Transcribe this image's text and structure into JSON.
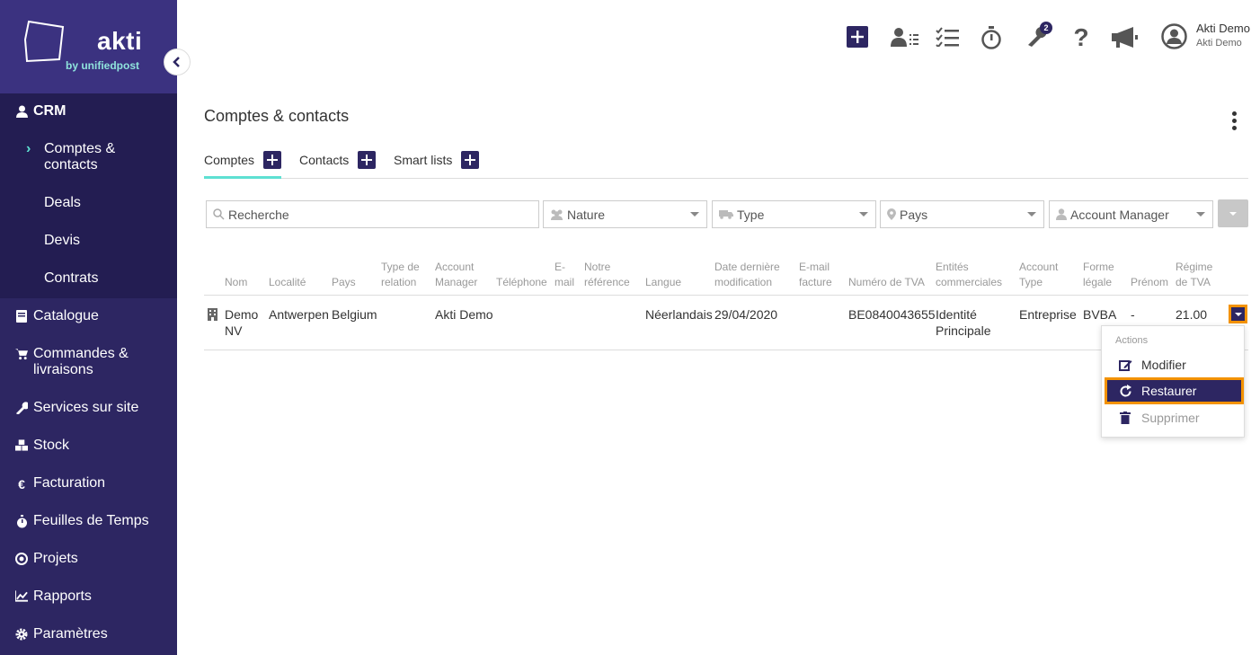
{
  "brand": {
    "name": "akti",
    "sub": "by unifiedpost"
  },
  "user": {
    "name": "Akti Demo",
    "company": "Akti Demo"
  },
  "topbar": {
    "notification_count": "2"
  },
  "sidebar": {
    "crm": "CRM",
    "crm_items": [
      "Comptes &\ncontacts",
      "Deals",
      "Devis",
      "Contrats"
    ],
    "items": [
      {
        "label": "Catalogue",
        "icon": "book-icon"
      },
      {
        "label": "Commandes &\nlivraisons",
        "icon": "cart-icon"
      },
      {
        "label": "Services sur site",
        "icon": "wrench-icon"
      },
      {
        "label": "Stock",
        "icon": "cubes-icon"
      },
      {
        "label": "Facturation",
        "icon": "euro-icon"
      },
      {
        "label": "Feuilles de Temps",
        "icon": "stopwatch-icon"
      },
      {
        "label": "Projets",
        "icon": "target-icon"
      },
      {
        "label": "Rapports",
        "icon": "chart-icon"
      },
      {
        "label": "Paramètres",
        "icon": "gear-icon"
      }
    ]
  },
  "page": {
    "title": "Comptes & contacts"
  },
  "tabs": [
    "Comptes",
    "Contacts",
    "Smart lists"
  ],
  "filters": {
    "search_placeholder": "Recherche",
    "nature": "Nature",
    "type": "Type",
    "pays": "Pays",
    "account_manager": "Account Manager"
  },
  "table": {
    "headers": {
      "nom": "Nom",
      "localite": "Localité",
      "pays": "Pays",
      "type_relation": "Type de\nrelation",
      "account_manager": "Account\nManager",
      "telephone": "Téléphone",
      "email": "E-\nmail",
      "notre_reference": "Notre\nréférence",
      "langue": "Langue",
      "date_modif": "Date dernière\nmodification",
      "email_facture": "E-mail\nfacture",
      "tva": "Numéro de TVA",
      "entites": "Entités\ncommerciales",
      "account_type": "Account\nType",
      "forme_legale": "Forme\nlégale",
      "prenom": "Prénom",
      "regime_tva": "Régime\nde TVA"
    },
    "row": {
      "nom": "Demo\nNV",
      "localite": "Antwerpen",
      "pays": "Belgium",
      "account_manager": "Akti Demo",
      "langue": "Néerlandais",
      "date_modif": "29/04/2020",
      "tva": "BE0840043655",
      "entites": "Identité\nPrincipale",
      "account_type": "Entreprise",
      "forme_legale": "BVBA",
      "prenom": "-",
      "regime_tva": "21.00"
    }
  },
  "actions": {
    "header": "Actions",
    "modifier": "Modifier",
    "restaurer": "Restaurer",
    "supprimer": "Supprimer"
  },
  "colors": {
    "primary": "#2d2662",
    "accent": "#5ee0d2",
    "highlight": "#f39200"
  }
}
